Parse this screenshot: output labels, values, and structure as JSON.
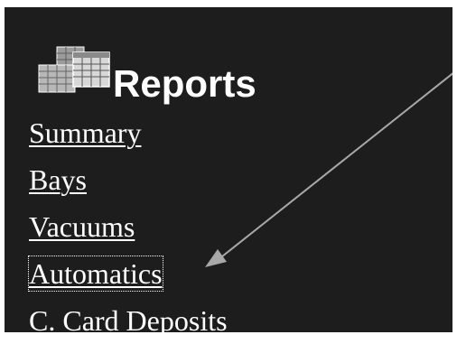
{
  "reports": {
    "title": "Reports",
    "icon": "reports-icon",
    "items": [
      {
        "label": "Summary"
      },
      {
        "label": "Bays"
      },
      {
        "label": "Vacuums"
      },
      {
        "label": "Automatics",
        "focused": true
      },
      {
        "label": "C. Card Deposits"
      }
    ]
  },
  "colors": {
    "background": "#1d1d1d",
    "text": "#ffffff",
    "arrow": "#a8a8a8"
  }
}
